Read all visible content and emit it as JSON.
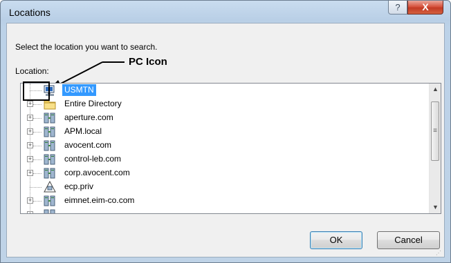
{
  "window": {
    "title": "Locations",
    "help_glyph": "?",
    "close_glyph": "X"
  },
  "prompt": "Select the location you want to search.",
  "location_label": "Location:",
  "annotation": "PC Icon",
  "tree": [
    {
      "label": "USMTN",
      "icon": "pc-icon",
      "expander": false,
      "selected": true
    },
    {
      "label": "Entire Directory",
      "icon": "folder-icon",
      "expander": true,
      "selected": false
    },
    {
      "label": "aperture.com",
      "icon": "domain-icon",
      "expander": true,
      "selected": false
    },
    {
      "label": "APM.local",
      "icon": "domain-icon",
      "expander": true,
      "selected": false
    },
    {
      "label": "avocent.com",
      "icon": "domain-icon",
      "expander": true,
      "selected": false
    },
    {
      "label": "control-leb.com",
      "icon": "domain-icon",
      "expander": true,
      "selected": false
    },
    {
      "label": "corp.avocent.com",
      "icon": "domain-icon",
      "expander": true,
      "selected": false
    },
    {
      "label": "ecp.priv",
      "icon": "warning-domain-icon",
      "expander": false,
      "selected": false
    },
    {
      "label": "eimnet.eim-co.com",
      "icon": "domain-icon",
      "expander": true,
      "selected": false
    }
  ],
  "buttons": {
    "ok": "OK",
    "cancel": "Cancel"
  },
  "colors": {
    "selection": "#3399ff",
    "close_button": "#c23a25"
  }
}
